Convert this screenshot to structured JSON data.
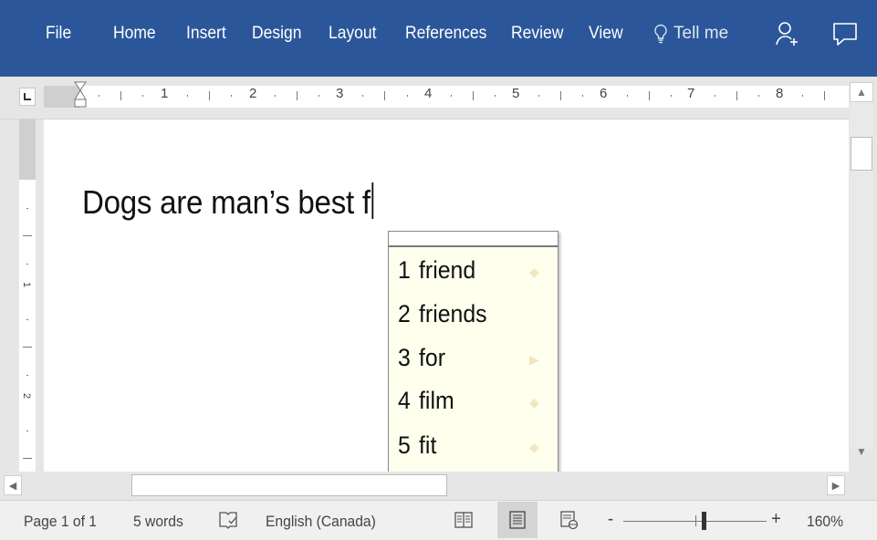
{
  "ribbon": {
    "tabs": [
      "File",
      "Home",
      "Insert",
      "Design",
      "Layout",
      "References",
      "Review",
      "View"
    ],
    "tell_me": "Tell me",
    "accent": "#2b579a"
  },
  "ruler": {
    "numbers": [
      "1",
      "2",
      "3",
      "4",
      "5",
      "6",
      "7",
      "8"
    ],
    "vertical_numbers": [
      "1",
      "2"
    ]
  },
  "document": {
    "text": "Dogs are man’s best f"
  },
  "suggestions": [
    {
      "index": "1",
      "word": "friend"
    },
    {
      "index": "2",
      "word": "friends"
    },
    {
      "index": "3",
      "word": "for"
    },
    {
      "index": "4",
      "word": "film"
    },
    {
      "index": "5",
      "word": "fit"
    }
  ],
  "status": {
    "page": "Page 1 of 1",
    "words": "5 words",
    "language": "English (Canada)",
    "zoom_minus": "-",
    "zoom_plus": "+",
    "zoom": "160%"
  },
  "icons": {
    "share": "person-plus-icon",
    "comments": "comment-icon",
    "tell_me": "lightbulb-icon",
    "proofing": "book-check-icon",
    "read_mode": "read-mode-icon",
    "print_layout": "print-layout-icon",
    "web_layout": "web-layout-icon"
  }
}
